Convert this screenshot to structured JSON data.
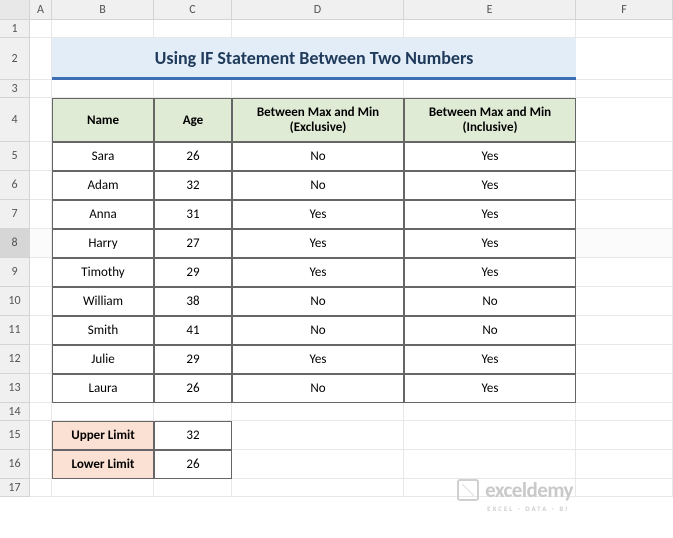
{
  "columns": [
    "A",
    "B",
    "C",
    "D",
    "E",
    "F"
  ],
  "rows_visible": 17,
  "title": "Using IF Statement Between Two Numbers",
  "table": {
    "headers": [
      "Name",
      "Age",
      "Between Max and Min (Exclusive)",
      "Between Max and Min (Inclusive)"
    ],
    "rows": [
      {
        "name": "Sara",
        "age": 26,
        "exclusive": "No",
        "inclusive": "Yes"
      },
      {
        "name": "Adam",
        "age": 32,
        "exclusive": "No",
        "inclusive": "Yes"
      },
      {
        "name": "Anna",
        "age": 31,
        "exclusive": "Yes",
        "inclusive": "Yes"
      },
      {
        "name": "Harry",
        "age": 27,
        "exclusive": "Yes",
        "inclusive": "Yes"
      },
      {
        "name": "Timothy",
        "age": 29,
        "exclusive": "Yes",
        "inclusive": "Yes"
      },
      {
        "name": "William",
        "age": 38,
        "exclusive": "No",
        "inclusive": "No"
      },
      {
        "name": "Smith",
        "age": 41,
        "exclusive": "No",
        "inclusive": "No"
      },
      {
        "name": "Julie",
        "age": 29,
        "exclusive": "Yes",
        "inclusive": "Yes"
      },
      {
        "name": "Laura",
        "age": 26,
        "exclusive": "No",
        "inclusive": "Yes"
      }
    ]
  },
  "limits": {
    "upper_label": "Upper Limit",
    "upper_value": 32,
    "lower_label": "Lower Limit",
    "lower_value": 26
  },
  "watermark": {
    "brand": "exceldemy",
    "tagline": "EXCEL · DATA · BI"
  },
  "selected_row": 8
}
